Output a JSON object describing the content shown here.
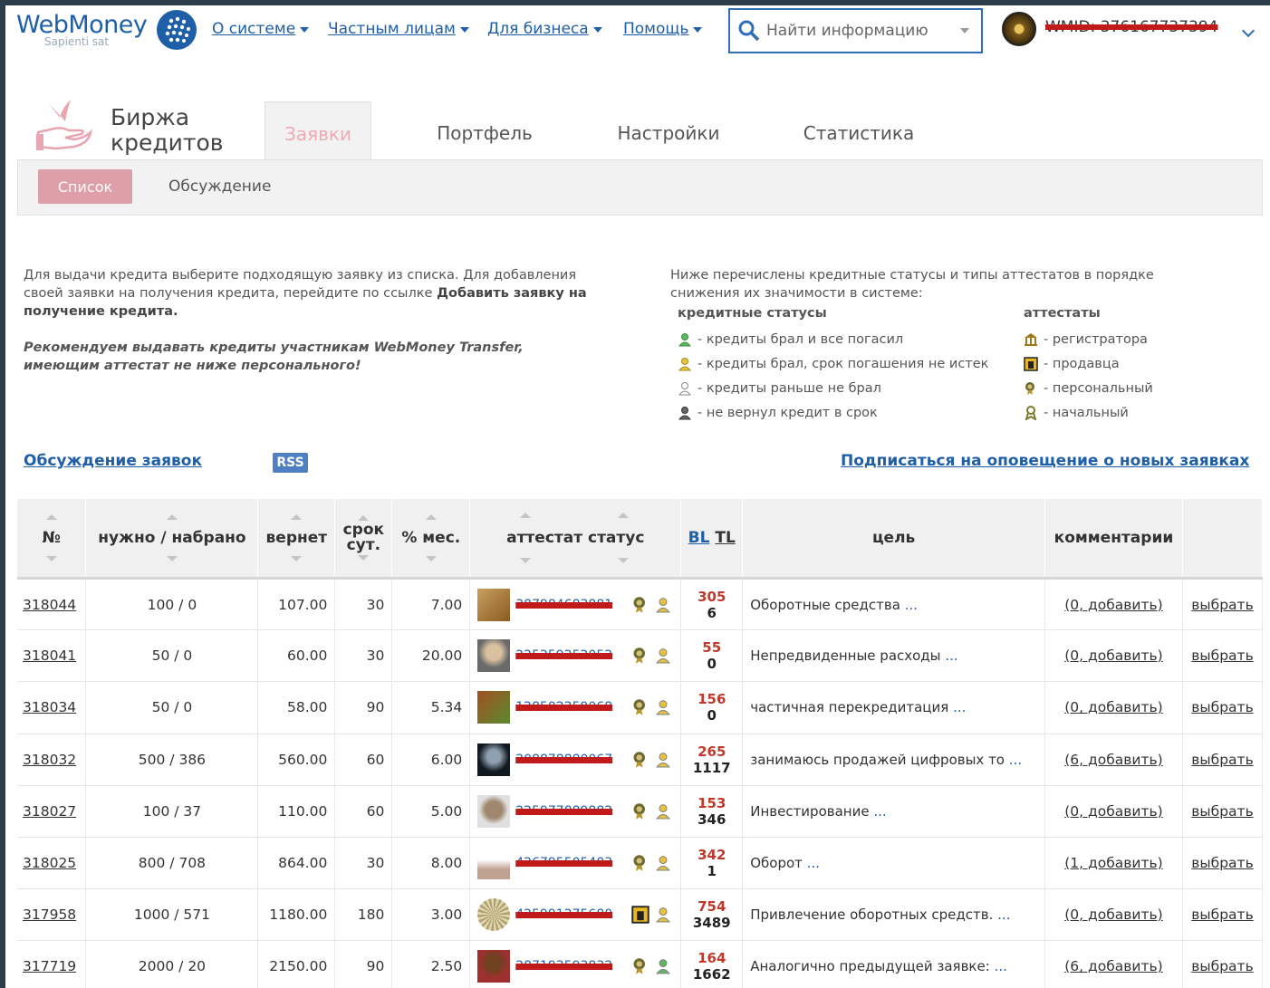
{
  "header": {
    "logo_word": "WebMoney",
    "logo_sub": "Sapienti sat",
    "nav": [
      {
        "label": "О системе"
      },
      {
        "label": "Частным лицам"
      },
      {
        "label": "Для бизнеса"
      },
      {
        "label": "Помощь"
      }
    ],
    "search_placeholder": "Найти информацию",
    "wmid": "WMID: 376167737394"
  },
  "module": {
    "title_line1": "Биржа",
    "title_line2": "кредитов",
    "tabs": [
      {
        "label": "Заявки",
        "active": true
      },
      {
        "label": "Портфель"
      },
      {
        "label": "Настройки"
      },
      {
        "label": "Статистика"
      }
    ],
    "sub_active": "Список",
    "sub_link": "Обсуждение"
  },
  "info": {
    "desc_text": "Для выдачи кредита выберите подходящую заявку из списка. Для добавления своей заявки на получения кредита, перейдите по ссылке",
    "desc_bold": "Добавить заявку на получение кредита.",
    "recommend": "Рекомендуем выдавать кредиты участникам WebMoney Transfer, имеющим аттестат не ниже персонального!",
    "legend_intro": "Ниже перечислены кредитные статусы и типы аттестатов в порядке снижения их значимости в системе:",
    "statuses_title": "кредитные статусы",
    "statuses": [
      {
        "text": "- кредиты брал и все погасил",
        "color": "#5cb85c"
      },
      {
        "text": "- кредиты брал, срок погашения не истек",
        "color": "#e8c33a"
      },
      {
        "text": "- кредиты раньше не брал",
        "color": "#ffffff"
      },
      {
        "text": "- не вернул кредит в срок",
        "color": "#555555"
      }
    ],
    "attestats_title": "аттестаты",
    "attestats": [
      {
        "text": "- регистратора"
      },
      {
        "text": "- продавца"
      },
      {
        "text": "- персональный"
      },
      {
        "text": "- начальный"
      }
    ]
  },
  "links": {
    "discussion": "Обсуждение заявок",
    "rss": "RSS",
    "subscribe": "Подписаться на оповещение о новых заявках"
  },
  "table": {
    "headers": {
      "no": "№",
      "need": "нужно / набрано",
      "return": "вернет",
      "term1": "срок",
      "term2": "сут.",
      "pct": "% мес.",
      "att": "аттестат статус",
      "bl": "BL",
      "tl": "TL",
      "goal": "цель",
      "comments": "комментарии"
    },
    "rows": [
      {
        "id": "318044",
        "need": "100 / 0",
        "ret": "107.00",
        "term": "30",
        "pct": "7.00",
        "wmid": "387984683881",
        "bl": "305",
        "tl": "6",
        "goal": "Оборотные средства",
        "ell": "...",
        "cmt": "(0, добавить)",
        "choose": "выбрать"
      },
      {
        "id": "318041",
        "need": "50 / 0",
        "ret": "60.00",
        "term": "30",
        "pct": "20.00",
        "wmid": "225259252052",
        "bl": "55",
        "tl": "0",
        "goal": "Непредвиденные расходы",
        "ell": "...",
        "cmt": "(0, добавить)",
        "choose": "выбрать"
      },
      {
        "id": "318034",
        "need": "50 / 0",
        "ret": "58.00",
        "term": "90",
        "pct": "5.34",
        "wmid": "128502259068",
        "bl": "156",
        "tl": "0",
        "goal": "частичная перекредитация",
        "ell": "...",
        "cmt": "(0, добавить)",
        "choose": "выбрать"
      },
      {
        "id": "318032",
        "need": "500 / 386",
        "ret": "560.00",
        "term": "60",
        "pct": "6.00",
        "wmid": "208878880067",
        "bl": "265",
        "tl": "1117",
        "goal": "занимаюсь продажей цифровых то",
        "ell": "...",
        "cmt": "(6, добавить)",
        "choose": "выбрать"
      },
      {
        "id": "318027",
        "need": "100 / 37",
        "ret": "110.00",
        "term": "60",
        "pct": "5.00",
        "wmid": "225977889882",
        "bl": "153",
        "tl": "346",
        "goal": "Инвестирование",
        "ell": "...",
        "cmt": "(0, добавить)",
        "choose": "выбрать"
      },
      {
        "id": "318025",
        "need": "800 / 708",
        "ret": "864.00",
        "term": "30",
        "pct": "8.00",
        "wmid": "426795505403",
        "bl": "342",
        "tl": "1",
        "goal": "Оборот",
        "ell": "...",
        "cmt": "(1, добавить)",
        "choose": "выбрать"
      },
      {
        "id": "317958",
        "need": "1000 / 571",
        "ret": "1180.00",
        "term": "180",
        "pct": "3.00",
        "wmid": "425991275680",
        "bl": "754",
        "tl": "3489",
        "goal": "Привлечение оборотных средств.",
        "ell": "...",
        "cmt": "(0, добавить)",
        "choose": "выбрать"
      },
      {
        "id": "317719",
        "need": "2000 / 20",
        "ret": "2150.00",
        "term": "90",
        "pct": "2.50",
        "wmid": "287193593832",
        "bl": "164",
        "tl": "1662",
        "goal": "Аналогично предыдущей заявке:",
        "ell": "...",
        "cmt": "(6, добавить)",
        "choose": "выбрать"
      }
    ]
  },
  "colors": {
    "brand_blue": "#1f5fa8",
    "tab_active_text": "#f0aab4",
    "sub_button": "#de9fa9",
    "bl_red": "#c0392b",
    "scribble_red": "#c01a1a",
    "frame": "#2d3e4a"
  },
  "icons": {
    "status_icon": "person-icon",
    "att_registrar": "building-icon",
    "att_seller": "seller-square-icon",
    "att_personal": "personal-badge-icon",
    "att_initial": "ribbon-icon"
  }
}
